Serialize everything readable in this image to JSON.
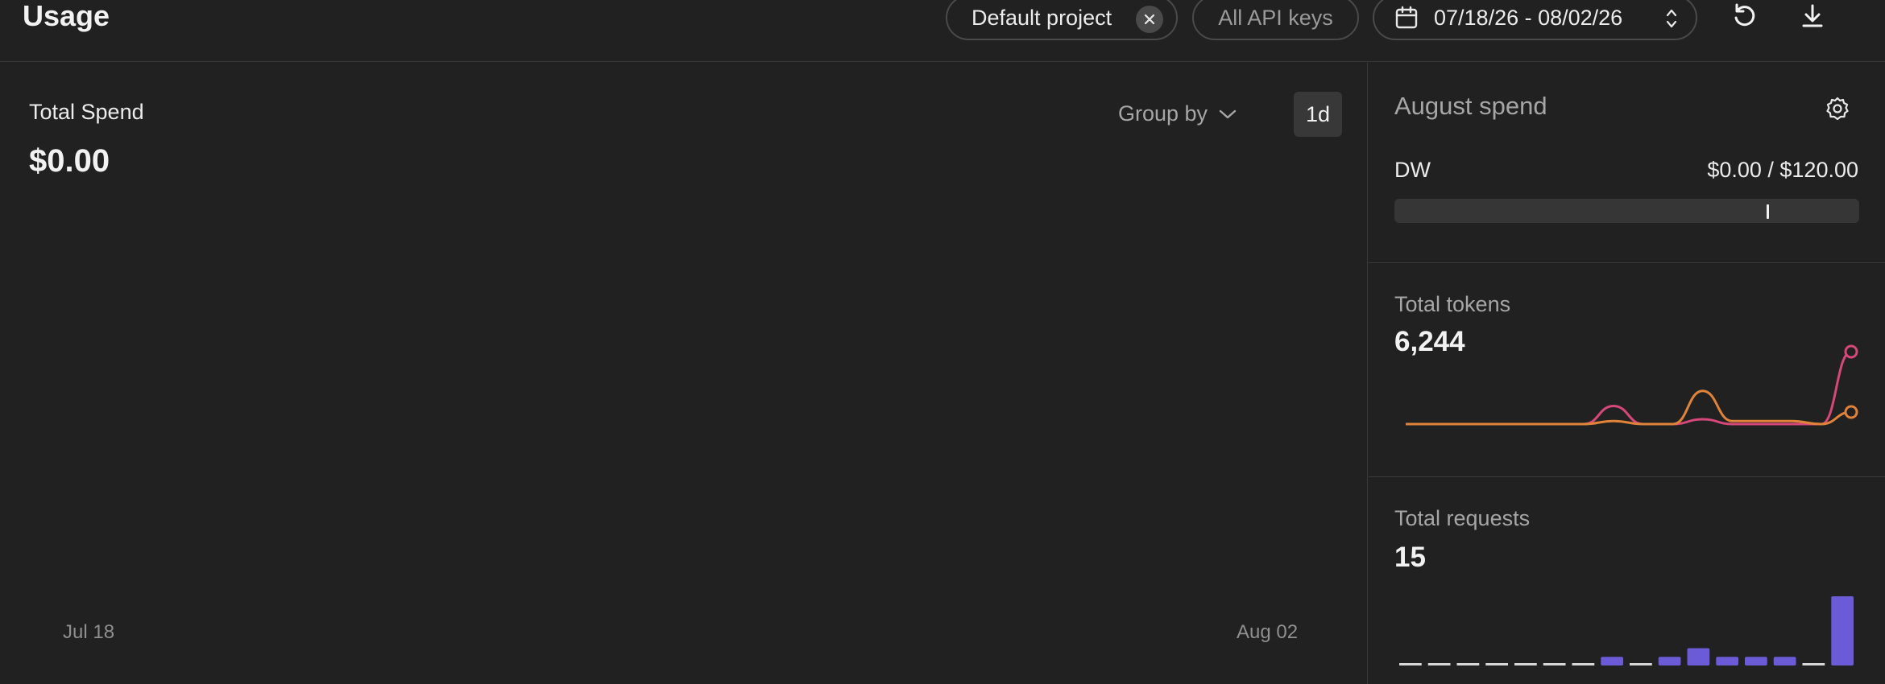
{
  "header": {
    "title": "Usage",
    "project_filter": "Default project",
    "api_keys_filter": "All API keys",
    "date_range": "07/18/26 - 08/02/26",
    "icons": [
      "close-icon",
      "calendar-icon",
      "sort-icon",
      "refresh-icon",
      "download-icon"
    ]
  },
  "spend": {
    "label": "Total Spend",
    "value": "$0.00",
    "group_by_label": "Group by",
    "interval": "1d",
    "x_start": "Jul 18",
    "x_end": "Aug 02"
  },
  "budget": {
    "title": "August spend",
    "name": "DW",
    "amount": "$0.00 / $120.00",
    "used_fraction": 0.0,
    "threshold_fraction": 0.8
  },
  "tokens": {
    "label": "Total tokens",
    "value": "6,244",
    "series": [
      {
        "color": "#d6477a",
        "values": [
          0,
          0,
          0,
          0,
          0,
          0,
          0,
          30,
          0,
          0,
          8,
          0,
          0,
          0,
          0,
          120
        ]
      },
      {
        "color": "#e0833a",
        "values": [
          0,
          0,
          0,
          0,
          0,
          0,
          0,
          5,
          0,
          0,
          55,
          5,
          5,
          5,
          0,
          20
        ]
      }
    ]
  },
  "requests": {
    "label": "Total requests",
    "value": "15",
    "bar_color": "#6b5bd6",
    "values": [
      0,
      0,
      0,
      0,
      0,
      0,
      0,
      1,
      0,
      1,
      2,
      1,
      1,
      1,
      0,
      8
    ]
  }
}
